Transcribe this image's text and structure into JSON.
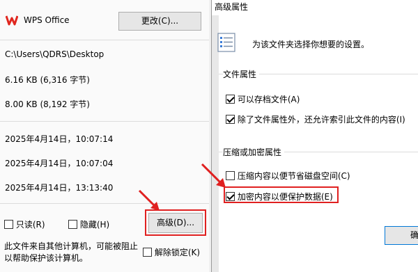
{
  "left_panel": {
    "app_name": "WPS Office",
    "change_button": "更改(C)...",
    "location": "C:\\Users\\QDRS\\Desktop",
    "size": "6.16 KB (6,316 字节)",
    "size_on_disk": "8.00 KB (8,192 字节)",
    "created": "2025年4月14日，10:07:14",
    "modified": "2025年4月14日，10:07:04",
    "accessed": "2025年4月14日，13:13:40",
    "readonly_label": "只读(R)",
    "hidden_label": "隐藏(H)",
    "advanced_button": "高级(D)...",
    "security_warning": "此文件来自其他计算机，可能被阻止以帮助保护该计算机。",
    "unblock_label": "解除锁定(K)"
  },
  "dialog": {
    "title": "高级属性",
    "description": "为该文件夹选择你想要的设置。",
    "file_attrs_group": "文件属性",
    "archive_label": "可以存档文件(A)",
    "index_label": "除了文件属性外，还允许索引此文件的内容(I)",
    "compress_group": "压缩或加密属性",
    "compress_label": "压缩内容以便节省磁盘空间(C)",
    "encrypt_label": "加密内容以便保护数据(E)",
    "ok_button": "确定"
  },
  "colors": {
    "highlight": "#e02020",
    "wps_red": "#e0271f"
  }
}
